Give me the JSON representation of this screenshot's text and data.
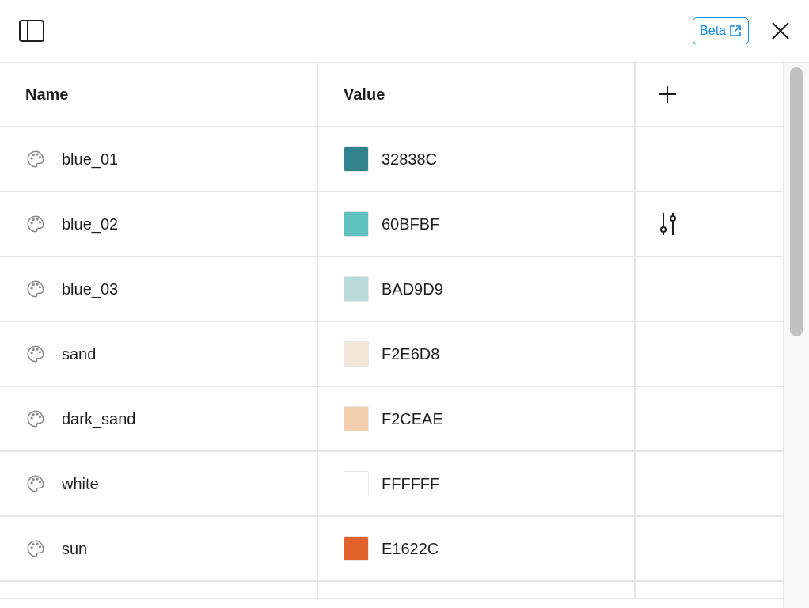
{
  "toolbar": {
    "badge": "Beta"
  },
  "table": {
    "columns": [
      "Name",
      "Value"
    ],
    "rows": [
      {
        "name": "blue_01",
        "value": "32838C",
        "color": "#32838c",
        "hovered": false
      },
      {
        "name": "blue_02",
        "value": "60BFBF",
        "color": "#60bfbf",
        "hovered": true
      },
      {
        "name": "blue_03",
        "value": "BAD9D9",
        "color": "#bad9d9",
        "hovered": false
      },
      {
        "name": "sand",
        "value": "F2E6D8",
        "color": "#f2e6d8",
        "hovered": false
      },
      {
        "name": "dark_sand",
        "value": "F2CEAE",
        "color": "#f2ceae",
        "hovered": false
      },
      {
        "name": "white",
        "value": "FFFFFF",
        "color": "#ffffff",
        "hovered": false
      },
      {
        "name": "sun",
        "value": "E1622C",
        "color": "#e1622c",
        "hovered": false
      }
    ]
  }
}
